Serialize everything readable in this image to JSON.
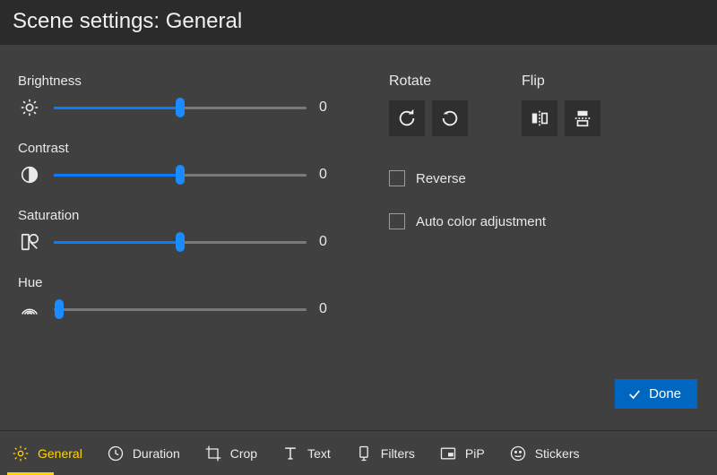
{
  "header": {
    "title": "Scene settings: General"
  },
  "sliders": {
    "brightness": {
      "label": "Brightness",
      "value": "0",
      "pct": 50
    },
    "contrast": {
      "label": "Contrast",
      "value": "0",
      "pct": 50
    },
    "saturation": {
      "label": "Saturation",
      "value": "0",
      "pct": 50
    },
    "hue": {
      "label": "Hue",
      "value": "0",
      "pct": 2
    }
  },
  "rotate_label": "Rotate",
  "flip_label": "Flip",
  "reverse_label": "Reverse",
  "autocolor_label": "Auto color adjustment",
  "reverse_checked": false,
  "autocolor_checked": false,
  "done_label": "Done",
  "tabs": [
    {
      "id": "general",
      "label": "General",
      "active": true
    },
    {
      "id": "duration",
      "label": "Duration",
      "active": false
    },
    {
      "id": "crop",
      "label": "Crop",
      "active": false
    },
    {
      "id": "text",
      "label": "Text",
      "active": false
    },
    {
      "id": "filters",
      "label": "Filters",
      "active": false
    },
    {
      "id": "pip",
      "label": "PiP",
      "active": false
    },
    {
      "id": "stickers",
      "label": "Stickers",
      "active": false
    }
  ]
}
